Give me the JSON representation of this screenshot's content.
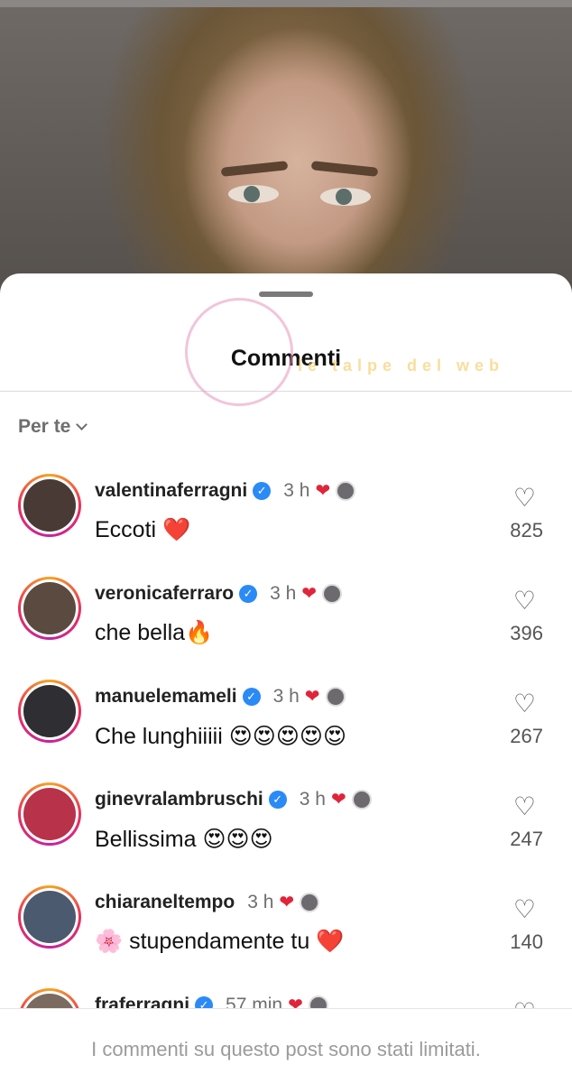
{
  "sheet": {
    "title": "Commenti",
    "filter_label": "Per te"
  },
  "comments": [
    {
      "username": "valentinaferragni",
      "verified": true,
      "time": "3 h",
      "text": "Eccoti ❤️",
      "likes": "825",
      "avatar_color": "#4a3a36"
    },
    {
      "username": "veronicaferraro",
      "verified": true,
      "time": "3 h",
      "text": "che bella🔥",
      "likes": "396",
      "avatar_color": "#5a4a40"
    },
    {
      "username": "manuelemameli",
      "verified": true,
      "time": "3 h",
      "text": "Che lunghiiiii 😍😍😍😍😍",
      "likes": "267",
      "avatar_color": "#2e2e33"
    },
    {
      "username": "ginevralambruschi",
      "verified": true,
      "time": "3 h",
      "text": "Bellissima 😍😍😍",
      "likes": "247",
      "avatar_color": "#b8324a"
    },
    {
      "username": "chiaraneltempo",
      "verified": false,
      "time": "3 h",
      "text": "🌸 stupendamente tu ❤️",
      "likes": "140",
      "avatar_color": "#4b5a6e"
    },
    {
      "username": "fraferragni",
      "verified": true,
      "time": "57 min",
      "text": "",
      "likes": "",
      "avatar_color": "#7a6a60"
    }
  ],
  "footer": {
    "notice": "I commenti su questo post sono stati limitati."
  },
  "watermark": {
    "text": "le talpe del web"
  },
  "colors": {
    "accent_blue": "#2a8af6",
    "heart_red": "#e0243a",
    "muted_gray": "#6e6e6e"
  }
}
